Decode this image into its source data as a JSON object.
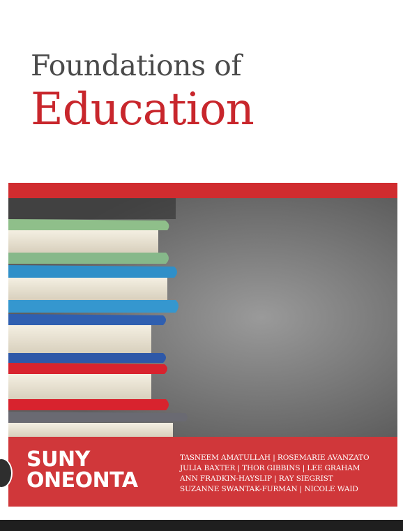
{
  "cover": {
    "title_line1": "Foundations of",
    "title_line2": "Education"
  },
  "publisher": {
    "line1": "SUNY",
    "line2": "ONEONTA"
  },
  "authors": [
    "TASNEEM AMATULLAH | ROSEMARIE AVANZATO",
    "JULIA BAXTER | THOR GIBBINS | LEE GRAHAM",
    "ANN FRADKIN-HAYSLIP | RAY SIEGRIST",
    "SUZANNE SWANTAK-FURMAN | NICOLE WAID"
  ],
  "colors": {
    "accent_red": "#c8262c",
    "band_red": "#d0373a",
    "title_gray": "#4a4a4a"
  },
  "image": {
    "subject": "stack-of-books-photo",
    "book_colors": [
      "#8fbf8a",
      "#2f8fc8",
      "#2f5fb0",
      "#d8232e"
    ]
  }
}
